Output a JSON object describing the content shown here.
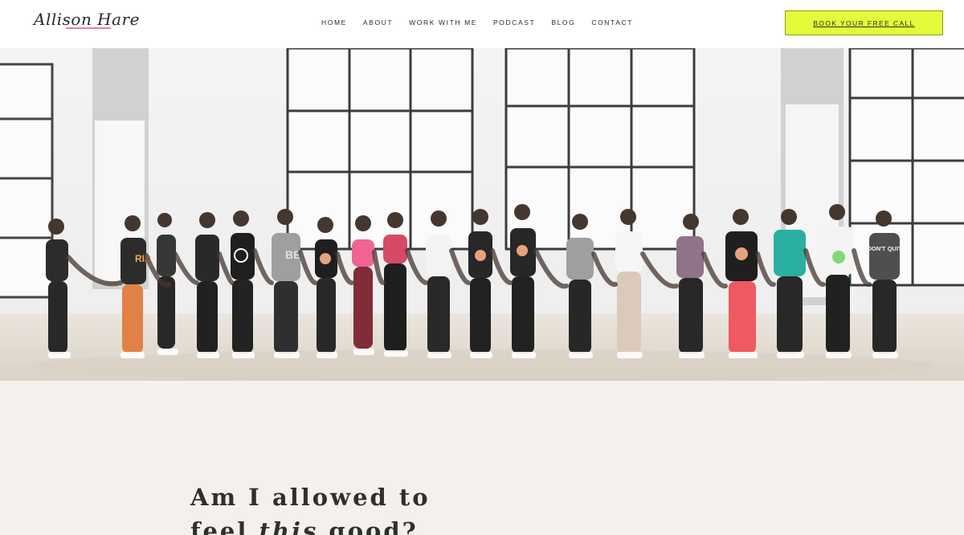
{
  "brand": {
    "logo_text": "Allison Hare"
  },
  "nav": {
    "items": [
      {
        "label": "HOME"
      },
      {
        "label": "ABOUT"
      },
      {
        "label": "WORK WITH ME"
      },
      {
        "label": "PODCAST"
      },
      {
        "label": "BLOG"
      },
      {
        "label": "CONTACT"
      }
    ]
  },
  "cta": {
    "label": "BOOK YOUR FREE CALL",
    "color": "#e4fb3c"
  },
  "hero": {
    "tank_labels": [
      "RIP",
      "BE",
      "DON'T QUIT"
    ]
  },
  "headline": {
    "line1": "Am I allowed to",
    "line2_before": "feel ",
    "line2_emphasis": "this",
    "line2_after": " good?"
  },
  "colors": {
    "accent_lime": "#e4fb3c",
    "logo_pink": "#f07ab0",
    "section_background": "#f4f1ec"
  }
}
